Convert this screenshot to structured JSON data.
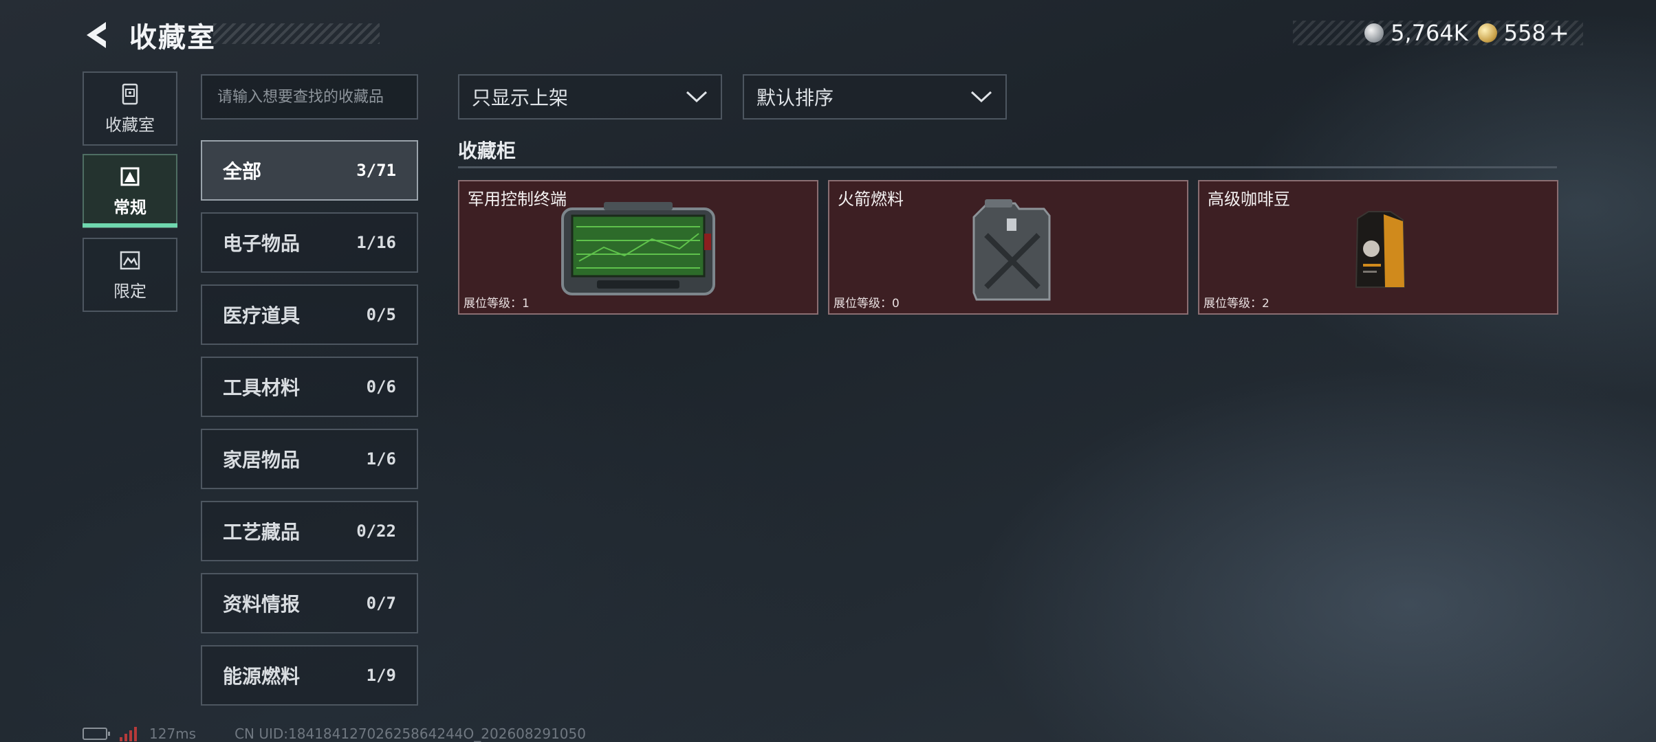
{
  "header": {
    "title": "收藏室",
    "currencies": [
      {
        "icon": "silver-coin-icon",
        "value": "5,764K"
      },
      {
        "icon": "gold-coin-icon",
        "value": "558"
      }
    ],
    "add_label": "+"
  },
  "side_nav": [
    {
      "label": "收藏室",
      "icon": "collection-room-icon"
    },
    {
      "label": "常规",
      "icon": "regular-icon",
      "active": true
    },
    {
      "label": "限定",
      "icon": "limited-icon"
    }
  ],
  "search": {
    "placeholder": "请输入想要查找的收藏品"
  },
  "categories": [
    {
      "name": "全部",
      "count": "3/71",
      "active": true
    },
    {
      "name": "电子物品",
      "count": "1/16"
    },
    {
      "name": "医疗道具",
      "count": "0/5"
    },
    {
      "name": "工具材料",
      "count": "0/6"
    },
    {
      "name": "家居物品",
      "count": "1/6"
    },
    {
      "name": "工艺藏品",
      "count": "0/22"
    },
    {
      "name": "资料情报",
      "count": "0/7"
    },
    {
      "name": "能源燃料",
      "count": "1/9"
    }
  ],
  "filters": {
    "display": "只显示上架",
    "sort": "默认排序"
  },
  "section": {
    "title": "收藏柜"
  },
  "items": [
    {
      "name": "军用控制终端",
      "level": "展位等级：1",
      "icon": "control-terminal-icon"
    },
    {
      "name": "火箭燃料",
      "level": "展位等级：0",
      "icon": "fuel-can-icon"
    },
    {
      "name": "高级咖啡豆",
      "level": "展位等级：2",
      "icon": "coffee-bag-icon"
    }
  ],
  "footer": {
    "ping": "127ms",
    "uid": "CN UID:18418412702625864244O_202608291050"
  },
  "colors": {
    "accent": "#6fd7ae",
    "card_bg": "#3d1f23",
    "panel_border": "#4d5660"
  }
}
